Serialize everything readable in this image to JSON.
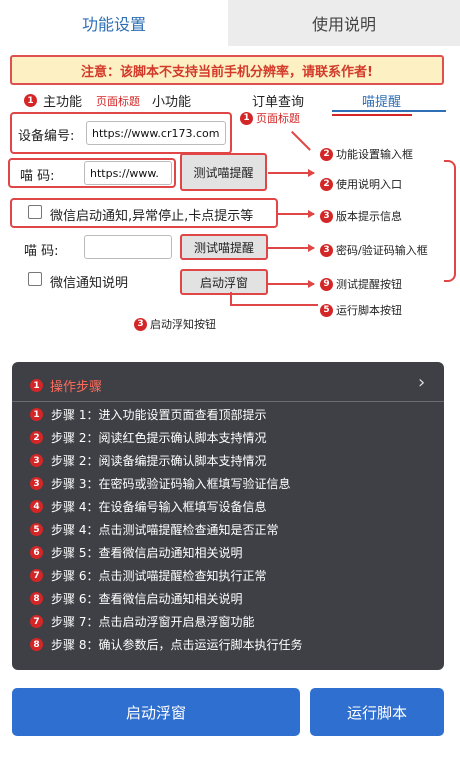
{
  "tabs": {
    "function_settings": "功能设置",
    "usage_instructions": "使用说明"
  },
  "warning": "注意：该脚本不支持当前手机分辨率，请联系作者!",
  "subtabs": {
    "main_badge": "1",
    "main": "主功能",
    "page_title_annot": "页面标题",
    "small": "小功能",
    "order": "订单查询",
    "meow": "喵提醒"
  },
  "page_title_badge": "1",
  "page_title": "页面标题",
  "form": {
    "device_label": "设备编号:",
    "device_value": "https://www.cr173.com",
    "meow_label": "喵      码:",
    "meow_value": "https://www.",
    "test_button": "测试喵提醒",
    "wechat_notify": "微信启动通知,异常停止,卡点提示等",
    "meow2_label": "喵      码:",
    "meow2_value": "",
    "test_button2": "测试喵提醒",
    "wechat_desc": "微信通知说明",
    "float_button": "启动浮窗"
  },
  "annotations": [
    {
      "badge": "2",
      "text": "功能设置输入框"
    },
    {
      "badge": "2",
      "text": "使用说明入口"
    },
    {
      "badge": "3",
      "text": "版本提示信息"
    },
    {
      "badge": "3",
      "text": "密码/验证码输入框"
    },
    {
      "badge": "9",
      "text": "测试提醒按钮"
    },
    {
      "badge": "5",
      "text": "运行脚本按钮"
    },
    {
      "badge": "3",
      "text": "启动浮知按钮"
    }
  ],
  "steps_panel": {
    "badge": "1",
    "title": "操作步骤",
    "chevron": "›",
    "steps": [
      {
        "badge": "1",
        "text": "步骤 1：进入功能设置页面查看顶部提示"
      },
      {
        "badge": "2",
        "text": "步骤 2：阅读红色提示确认脚本支持情况"
      },
      {
        "badge": "3",
        "text": "步骤 2：阅读备编提示确认脚本支持情况"
      },
      {
        "badge": "3",
        "text": "步骤 3：在密码或验证码输入框填写验证信息"
      },
      {
        "badge": "4",
        "text": "步骤 4：在设备编号输入框填写设备信息"
      },
      {
        "badge": "5",
        "text": "步骤 4：点击测试喵提醒检查通知是否正常"
      },
      {
        "badge": "6",
        "text": "步骤 5：查看微信启动通知相关说明"
      },
      {
        "badge": "7",
        "text": "步骤 6：点击测试喵提醒检查知执行正常"
      },
      {
        "badge": "8",
        "text": "步骤 6：查看微信启动通知相关说明"
      },
      {
        "badge": "7",
        "text": "步骤 7：点击启动浮窗开启悬浮窗功能"
      },
      {
        "badge": "8",
        "text": "步骤 8：确认参数后，点击运运行脚本执行任务"
      }
    ]
  },
  "bottom": {
    "float_button": "启动浮窗",
    "run_button": "运行脚本"
  },
  "colors": {
    "accent_blue": "#2f6fd0",
    "alert_red": "#d42626",
    "panel_bg": "#3f4046",
    "warning_bg": "#fdf1c4"
  }
}
